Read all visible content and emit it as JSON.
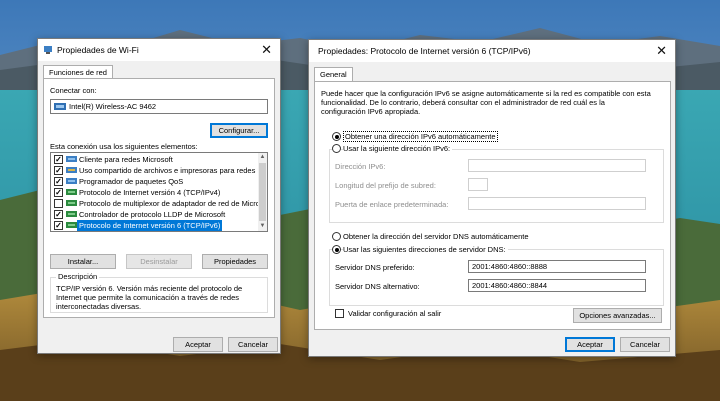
{
  "wifi_dialog": {
    "title": "Propiedades de Wi-Fi",
    "tab_label": "Funciones de red",
    "connect_using_label": "Conectar con:",
    "adapter_name": "Intel(R) Wireless-AC 9462",
    "configure_button": "Configurar...",
    "items_label": "Esta conexión usa los siguientes elementos:",
    "items": [
      {
        "label": "Cliente para redes Microsoft",
        "checked": true,
        "icon": "network-client-icon"
      },
      {
        "label": "Uso compartido de archivos e impresoras para redes M",
        "checked": true,
        "icon": "file-sharing-icon"
      },
      {
        "label": "Programador de paquetes QoS",
        "checked": true,
        "icon": "qos-scheduler-icon"
      },
      {
        "label": "Protocolo de Internet versión 4 (TCP/IPv4)",
        "checked": true,
        "icon": "protocol-icon"
      },
      {
        "label": "Protocolo de multiplexor de adaptador de red de Micros",
        "checked": false,
        "icon": "protocol-icon"
      },
      {
        "label": "Controlador de protocolo LLDP de Microsoft",
        "checked": true,
        "icon": "protocol-icon"
      },
      {
        "label": "Protocolo de Internet versión 6 (TCP/IPv6)",
        "checked": true,
        "icon": "protocol-icon",
        "selected": true
      }
    ],
    "install_button": "Instalar...",
    "uninstall_button": "Desinstalar",
    "properties_button": "Propiedades",
    "description_heading": "Descripción",
    "description_text_1": "TCP/IP versión 6. Versión más reciente del protocolo de",
    "description_text_2": "Internet que permite la comunicación a través de redes",
    "description_text_3": "interconectadas diversas.",
    "ok_button": "Aceptar",
    "cancel_button": "Cancelar"
  },
  "ipv6_dialog": {
    "title": "Propiedades: Protocolo de Internet versión 6 (TCP/IPv6)",
    "tab_label": "General",
    "intro_line_1": "Puede hacer que la configuración IPv6 se asigne automáticamente si la red es compatible con esta",
    "intro_line_2": "funcionalidad. De lo contrario, deberá consultar con el administrador de red cuál es la",
    "intro_line_3": "configuración IPv6 apropiada.",
    "auto_ip_option": "Obtener una dirección IPv6 automáticamente",
    "manual_ip_option": "Usar la siguiente dirección IPv6:",
    "ipv6_address_label": "Dirección IPv6:",
    "prefix_length_label": "Longitud del prefijo de subred:",
    "gateway_label": "Puerta de enlace predeterminada:",
    "auto_dns_option": "Obtener la dirección del servidor DNS automáticamente",
    "manual_dns_option": "Usar las siguientes direcciones de servidor DNS:",
    "preferred_dns_label": "Servidor DNS preferido:",
    "preferred_dns_value": "2001:4860:4860::8888",
    "alternate_dns_label": "Servidor DNS alternativo:",
    "alternate_dns_value": "2001:4860:4860::8844",
    "validate_on_exit_label": "Validar configuración al salir",
    "advanced_button": "Opciones avanzadas...",
    "ok_button": "Aceptar",
    "cancel_button": "Cancelar"
  },
  "colors": {
    "accent": "#0078d7",
    "dialog_background": "#f0f0f0",
    "selection": "#0078d7"
  }
}
